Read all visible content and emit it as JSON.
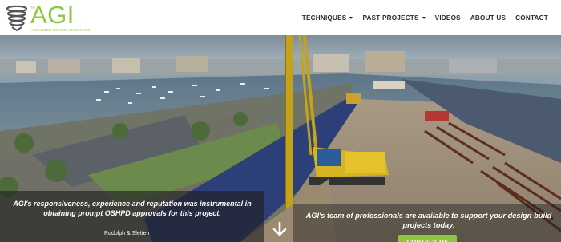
{
  "logo": {
    "name": "AGI",
    "trademark": "TM",
    "tagline": "Advanced Geosolutions Inc",
    "icon": "spiral-drill-icon"
  },
  "nav": {
    "items": [
      {
        "label": "TECHNIQUES",
        "has_dropdown": true
      },
      {
        "label": "PAST PROJECTS",
        "has_dropdown": true
      },
      {
        "label": "VIDEOS",
        "has_dropdown": false
      },
      {
        "label": "ABOUT US",
        "has_dropdown": false
      },
      {
        "label": "CONTACT",
        "has_dropdown": false
      }
    ]
  },
  "hero": {
    "testimonial": {
      "quote": "AGI's responsiveness, experience and reputation was instrumental in obtaining prompt OSHPD approvals for this project.",
      "attribution": "Rudolph & Sletten"
    },
    "scroll_icon": "arrow-down-icon",
    "callout": {
      "text": "AGI's team of professionals are available to support your design-build projects today.",
      "button_label": "CONTACT US"
    }
  },
  "colors": {
    "brand_green": "#8dc63f",
    "nav_text": "#2b2b2b",
    "overlay": "#1e1e1e"
  }
}
